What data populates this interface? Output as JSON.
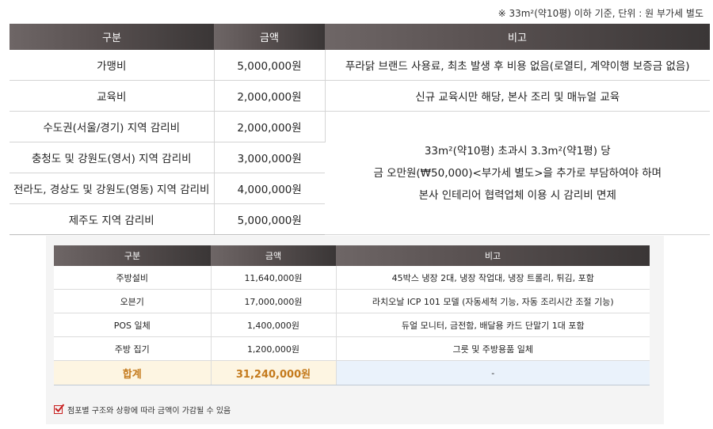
{
  "top_note": "※ 33m²(약10평) 이하 기준, 단위 : 원 부가세 별도",
  "table1": {
    "headers": [
      "구분",
      "금액",
      "비고"
    ],
    "rows": [
      {
        "label": "가맹비",
        "amount": "5,000,000원",
        "note": "푸라닭 브랜드 사용료, 최초 발생 후 비용 없음(로열티, 계약이행 보증금 없음)"
      },
      {
        "label": "교육비",
        "amount": "2,000,000원",
        "note": "신규 교육시만 해당, 본사 조리 및 매뉴얼 교육"
      },
      {
        "label": "수도권(서울/경기) 지역 감리비",
        "amount": "2,000,000원"
      },
      {
        "label": "충청도 및 강원도(영서) 지역 감리비",
        "amount": "3,000,000원"
      },
      {
        "label": "전라도, 경상도 및 강원도(영동) 지역 감리비",
        "amount": "4,000,000원"
      },
      {
        "label": "제주도 지역 감리비",
        "amount": "5,000,000원"
      }
    ],
    "merged_note": [
      "33m²(약10평) 초과시 3.3m²(약1평) 당",
      "금 오만원(₩50,000)<부가세 별도>을 추가로 부담하여야 하며",
      "본사 인테리어 협력업체 이용 시 감리비 면제"
    ]
  },
  "table2": {
    "headers": [
      "구분",
      "금액",
      "비고"
    ],
    "rows": [
      {
        "label": "주방설비",
        "amount": "11,640,000원",
        "note": "45박스 냉장 2대, 냉장 작업대, 냉장 트롤리, 튀김, 포함"
      },
      {
        "label": "오븐기",
        "amount": "17,000,000원",
        "note": "라치오날 ICP 101 모델 (자동세척 기능, 자동 조리시간 조절 기능)"
      },
      {
        "label": "POS 일체",
        "amount": "1,400,000원",
        "note": "듀얼 모니터, 금전함, 배달용 카드 단말기 1대 포함"
      },
      {
        "label": "주방 집기",
        "amount": "1,200,000원",
        "note": "그릇 및 주방용품 일체"
      }
    ],
    "total": {
      "label": "합계",
      "amount": "31,240,000원",
      "note": "-"
    }
  },
  "footnote": "점포별 구조와 상황에 따라 금액이 가감될 수 있음",
  "colors": {
    "header_start": "#6e6666",
    "header_end": "#3a3636",
    "total_text": "#c47a1c",
    "check_red": "#c81e1e"
  }
}
